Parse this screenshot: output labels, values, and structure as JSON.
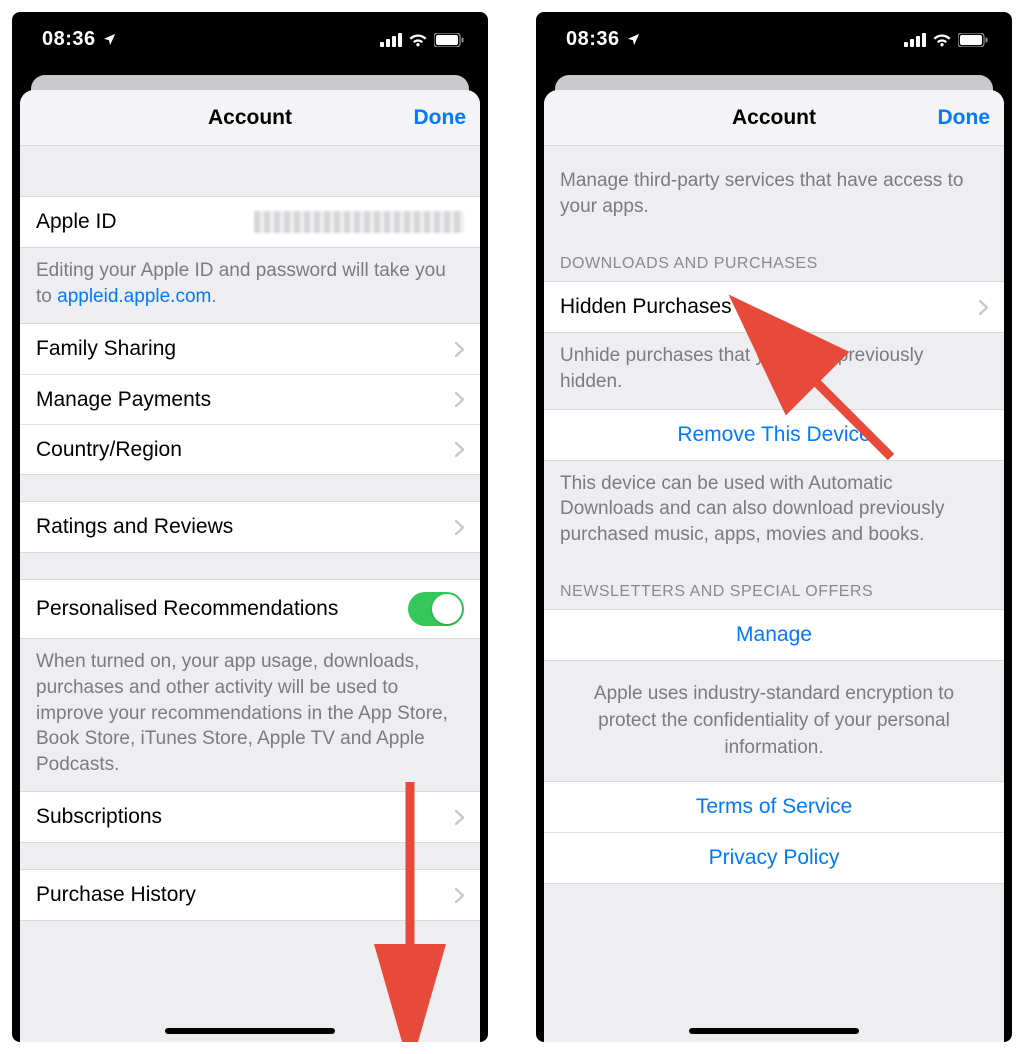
{
  "statusbar": {
    "time": "08:36"
  },
  "navbar": {
    "title": "Account",
    "done": "Done"
  },
  "left": {
    "appleId": {
      "label": "Apple ID"
    },
    "appleIdFooterPrefix": "Editing your Apple ID and password will take you to ",
    "appleIdFooterLink": "appleid.apple.com",
    "appleIdFooterSuffix": ".",
    "familySharing": "Family Sharing",
    "managePayments": "Manage Payments",
    "countryRegion": "Country/Region",
    "ratingsReviews": "Ratings and Reviews",
    "personalised": "Personalised Recommendations",
    "personalisedFooter": "When turned on, your app usage, downloads, purchases and other activity will be used to improve your recommendations in the App Store, Book Store, iTunes Store, Apple TV and Apple Podcasts.",
    "subscriptions": "Subscriptions",
    "purchaseHistory": "Purchase History"
  },
  "right": {
    "thirdPartyFooter": "Manage third-party services that have access to your apps.",
    "downloadsHeader": "Downloads and Purchases",
    "hiddenPurchases": "Hidden Purchases",
    "hiddenFooter": "Unhide purchases that you have previously hidden.",
    "removeDevice": "Remove This Device",
    "removeDeviceFooter": "This device can be used with Automatic Downloads and can also download previously purchased music, apps, movies and books.",
    "newslettersHeader": "Newsletters and Special Offers",
    "manage": "Manage",
    "encryptionNote": "Apple uses industry-standard encryption to protect the confidentiality of your personal information.",
    "terms": "Terms of Service",
    "privacy": "Privacy Policy"
  }
}
